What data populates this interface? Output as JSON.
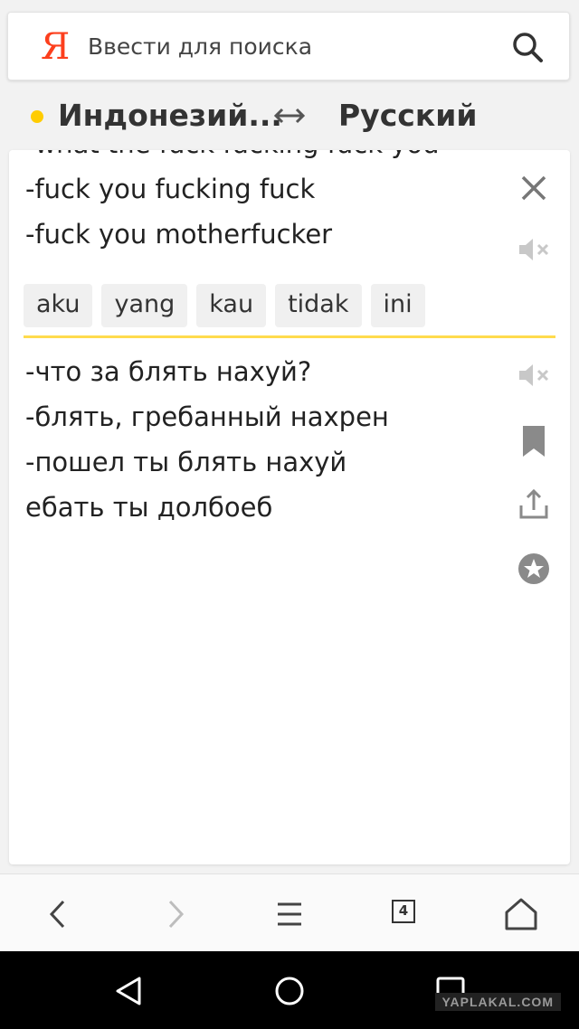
{
  "search": {
    "logo": "Я",
    "placeholder": "Ввести для поиска"
  },
  "languages": {
    "source": "Индонезий...",
    "target": "Русский"
  },
  "source_text": {
    "clipped_line": "-what the fuck fucking fuck you",
    "lines": [
      "-fuck you fucking fuck",
      "-fuck you motherfucker"
    ]
  },
  "suggestions": [
    "aku",
    "yang",
    "kau",
    "tidak",
    "ini"
  ],
  "translation": {
    "lines": [
      "-что за блять нахуй?",
      "-блять, гребанный нахрен",
      "-пошел ты блять нахуй",
      "ебать ты долбоеб"
    ]
  },
  "browser": {
    "tab_count": "4"
  },
  "watermark": "YAPLAKAL.COM",
  "colors": {
    "accent_yellow": "#ffdb4d",
    "logo_red": "#fc3f1d",
    "icon_gray": "#8a8a8a",
    "muted_icon": "#c8c8c8"
  }
}
